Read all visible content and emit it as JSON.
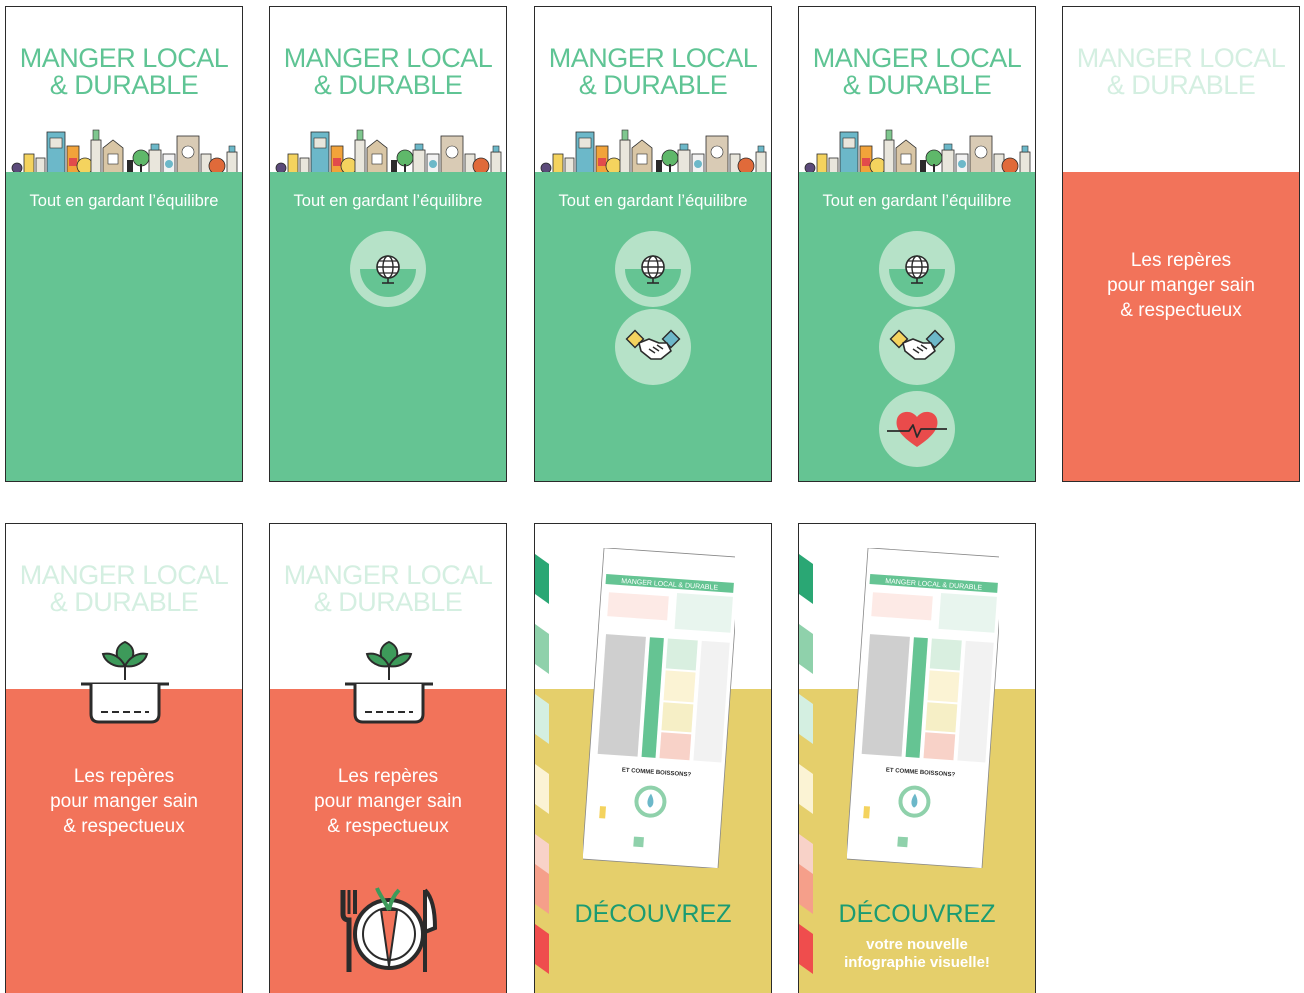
{
  "title": {
    "line1": "MANGER LOCAL",
    "line2": "& DURABLE"
  },
  "subtitle": "Tout en gardant l’équilibre",
  "message": {
    "line1": "Les repères",
    "line2": "pour manger sain",
    "line3": "& respectueux"
  },
  "discover": {
    "label": "DÉCOUVREZ",
    "sub_line1": "votre nouvelle",
    "sub_line2": "infographie visuelle!"
  },
  "infographic": {
    "title": "MANGER LOCAL & DURABLE",
    "section": "ET COMME BOISSONS?"
  },
  "icons": [
    "globe-icon",
    "handshake-icon",
    "heart-icon",
    "pot-with-leaves-icon",
    "plate-carrot-icon",
    "food-skyline-illustration"
  ],
  "colors": {
    "green": "#65c493",
    "red": "#f2735a",
    "yellow": "#e5cf6b",
    "title_green": "#5fc494",
    "discover_green": "#1a9b72"
  }
}
